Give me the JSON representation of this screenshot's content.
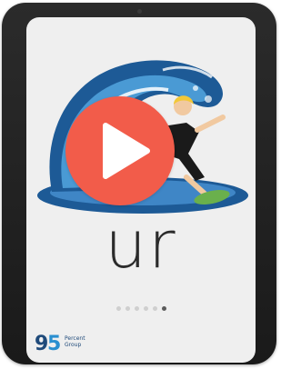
{
  "lesson": {
    "word": "ur",
    "total_slides": 6,
    "active_slide": 6
  },
  "player": {
    "icon": "play-icon",
    "color": "#f25c4a"
  },
  "logo": {
    "number": "95",
    "line1": "Percent",
    "line2": "Group"
  },
  "colors": {
    "wave_dark": "#1d5a96",
    "wave_light": "#4a9ad4",
    "board": "#6ab04c"
  }
}
